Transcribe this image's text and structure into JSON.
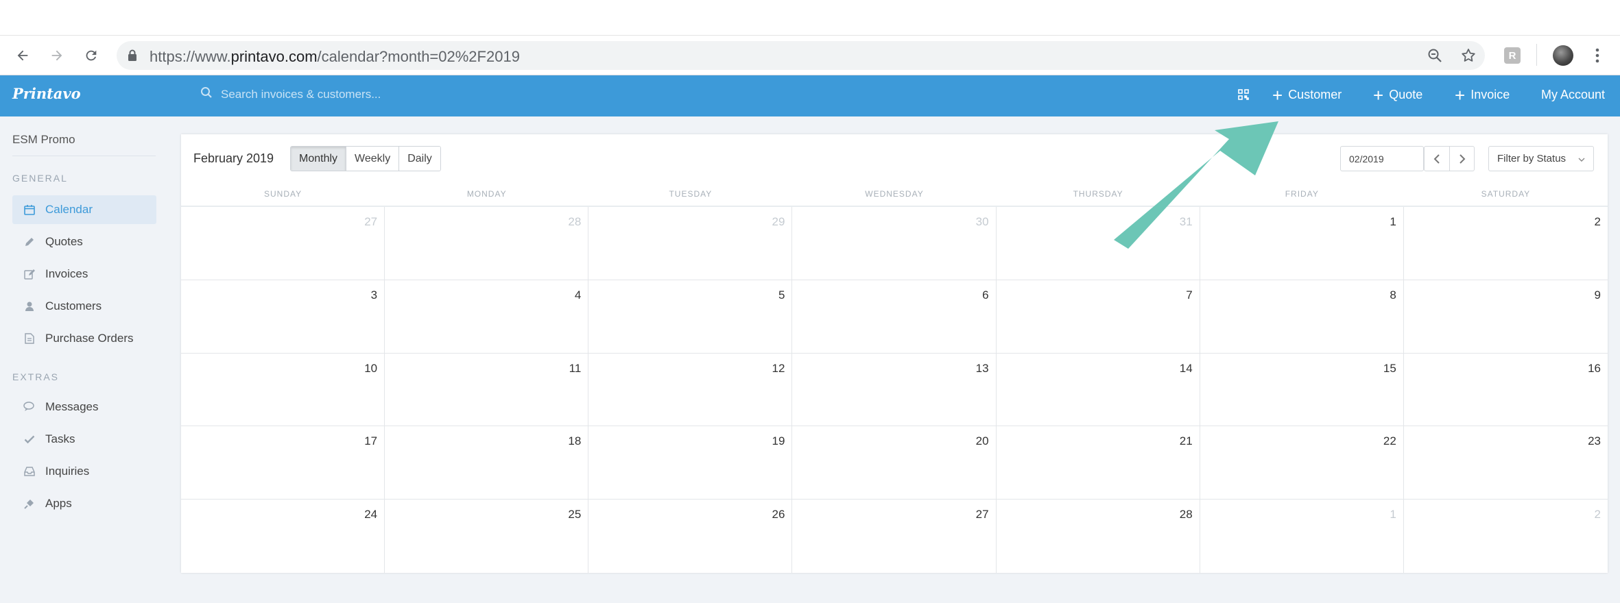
{
  "browser": {
    "url_prefix": "https://www.",
    "url_host": "printavo.com",
    "url_path": "/calendar?month=02%2F2019",
    "extension_letter": "R"
  },
  "app": {
    "logo": "Printavo",
    "search_placeholder": "Search invoices & customers...",
    "header_links": {
      "customer": "Customer",
      "quote": "Quote",
      "invoice": "Invoice",
      "account": "My Account"
    }
  },
  "sidebar": {
    "org": "ESM Promo",
    "general_title": "GENERAL",
    "general_items": [
      {
        "label": "Calendar",
        "icon": "calendar-icon"
      },
      {
        "label": "Quotes",
        "icon": "pencil-icon"
      },
      {
        "label": "Invoices",
        "icon": "edit-icon"
      },
      {
        "label": "Customers",
        "icon": "user-icon"
      },
      {
        "label": "Purchase Orders",
        "icon": "document-icon"
      }
    ],
    "extras_title": "EXTRAS",
    "extras_items": [
      {
        "label": "Messages",
        "icon": "chat-icon"
      },
      {
        "label": "Tasks",
        "icon": "check-icon"
      },
      {
        "label": "Inquiries",
        "icon": "inbox-icon"
      },
      {
        "label": "Apps",
        "icon": "plug-icon"
      }
    ]
  },
  "calendar": {
    "title": "February 2019",
    "views": [
      "Monthly",
      "Weekly",
      "Daily"
    ],
    "active_view": "Monthly",
    "date_value": "02/2019",
    "filter_label": "Filter by Status",
    "weekdays": [
      "SUNDAY",
      "MONDAY",
      "TUESDAY",
      "WEDNESDAY",
      "THURSDAY",
      "FRIDAY",
      "SATURDAY"
    ],
    "weeks": [
      [
        "27",
        "28",
        "29",
        "30",
        "31",
        "1",
        "2"
      ],
      [
        "3",
        "4",
        "5",
        "6",
        "7",
        "8",
        "9"
      ],
      [
        "10",
        "11",
        "12",
        "13",
        "14",
        "15",
        "16"
      ],
      [
        "17",
        "18",
        "19",
        "20",
        "21",
        "22",
        "23"
      ],
      [
        "24",
        "25",
        "26",
        "27",
        "28",
        "1",
        "2"
      ]
    ]
  },
  "colors": {
    "header_blue": "#3d9ad9",
    "annotation_arrow": "#6cc6b6"
  }
}
